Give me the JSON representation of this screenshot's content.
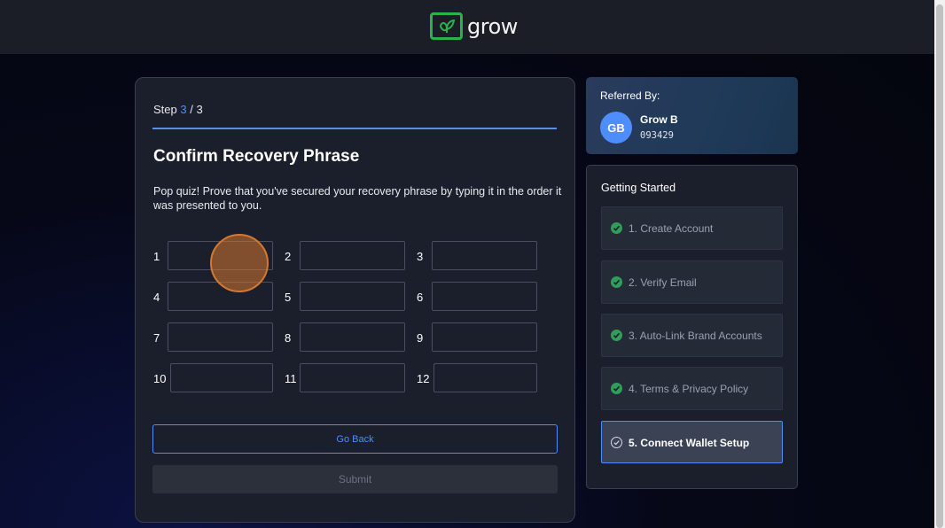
{
  "header": {
    "logo_text": "grow",
    "logo_icon": "leaf-icon",
    "brand_color": "#2bb24c"
  },
  "recovery": {
    "step_label": "Step",
    "step_current": "3",
    "step_separator": "/",
    "step_total": "3",
    "title": "Confirm Recovery Phrase",
    "description": "Pop quiz! Prove that you've secured your recovery phrase by typing it in the order it was presented to you.",
    "words": [
      {
        "num": "1",
        "value": ""
      },
      {
        "num": "2",
        "value": ""
      },
      {
        "num": "3",
        "value": ""
      },
      {
        "num": "4",
        "value": ""
      },
      {
        "num": "5",
        "value": ""
      },
      {
        "num": "6",
        "value": ""
      },
      {
        "num": "7",
        "value": ""
      },
      {
        "num": "8",
        "value": ""
      },
      {
        "num": "9",
        "value": ""
      },
      {
        "num": "10",
        "value": ""
      },
      {
        "num": "11",
        "value": ""
      },
      {
        "num": "12",
        "value": ""
      }
    ],
    "go_back_label": "Go Back",
    "submit_label": "Submit",
    "accent_color": "#4d8dff"
  },
  "referral": {
    "label": "Referred By:",
    "avatar_initials": "GB",
    "name": "Grow B",
    "code": "093429"
  },
  "getting_started": {
    "title": "Getting Started",
    "items": [
      {
        "label": "1. Create Account",
        "status": "complete"
      },
      {
        "label": "2. Verify Email",
        "status": "complete"
      },
      {
        "label": "3. Auto-Link Brand Accounts",
        "status": "complete"
      },
      {
        "label": "4. Terms & Privacy Policy",
        "status": "complete"
      },
      {
        "label": "5. Connect Wallet Setup",
        "status": "current"
      }
    ]
  }
}
